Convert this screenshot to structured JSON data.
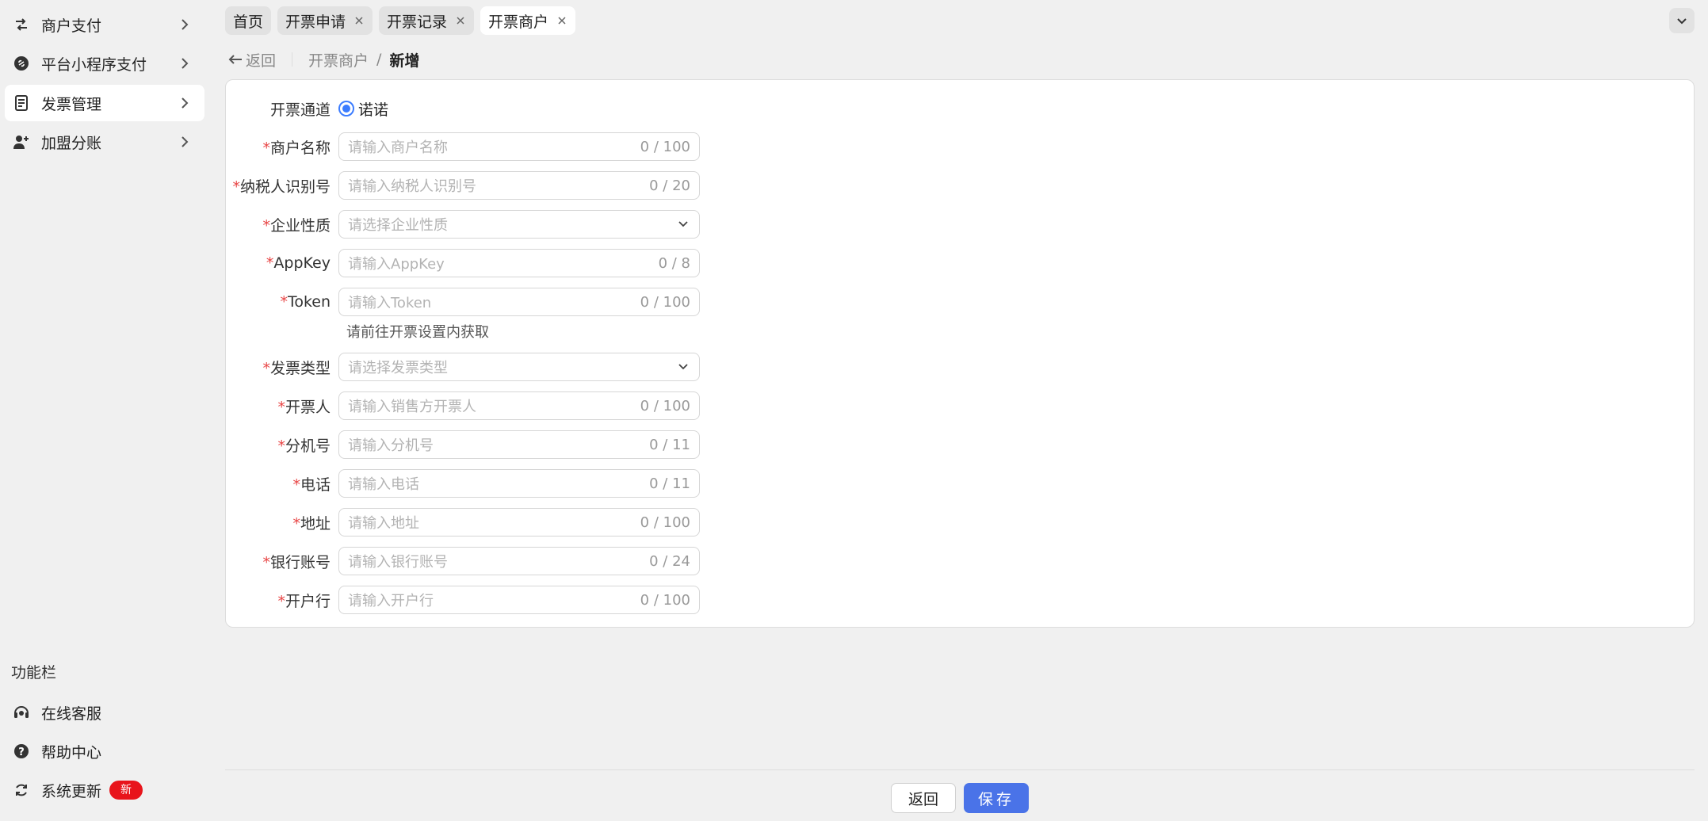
{
  "sidebar": {
    "items": [
      {
        "label": "商户支付",
        "icon": "transfer-icon"
      },
      {
        "label": "平台小程序支付",
        "icon": "link-icon"
      },
      {
        "label": "发票管理",
        "icon": "receipt-icon"
      },
      {
        "label": "加盟分账",
        "icon": "user-add-icon"
      }
    ],
    "func_title": "功能栏",
    "func_items": [
      {
        "label": "在线客服",
        "icon": "headset-icon"
      },
      {
        "label": "帮助中心",
        "icon": "help-icon"
      },
      {
        "label": "系统更新",
        "icon": "refresh-icon",
        "badge": "新"
      }
    ]
  },
  "tabs": [
    {
      "label": "首页",
      "closable": false
    },
    {
      "label": "开票申请",
      "closable": true
    },
    {
      "label": "开票记录",
      "closable": true
    },
    {
      "label": "开票商户",
      "closable": true,
      "active": true
    }
  ],
  "breadcrumb": {
    "back": "返回",
    "parent": "开票商户",
    "separator": "/",
    "current": "新增"
  },
  "form": {
    "channel": {
      "label": "开票通道",
      "option": "诺诺"
    },
    "merchant_name": {
      "label": "商户名称",
      "placeholder": "请输入商户名称",
      "count": "0 / 100"
    },
    "tax_id": {
      "label": "纳税人识别号",
      "placeholder": "请输入纳税人识别号",
      "count": "0 / 20"
    },
    "enterprise_type": {
      "label": "企业性质",
      "placeholder": "请选择企业性质"
    },
    "app_key": {
      "label": "AppKey",
      "placeholder": "请输入AppKey",
      "count": "0 / 8"
    },
    "token": {
      "label": "Token",
      "placeholder": "请输入Token",
      "count": "0 / 100",
      "hint": "请前往开票设置内获取"
    },
    "invoice_type": {
      "label": "发票类型",
      "placeholder": "请选择发票类型"
    },
    "issuer": {
      "label": "开票人",
      "placeholder": "请输入销售方开票人",
      "count": "0 / 100"
    },
    "extension": {
      "label": "分机号",
      "placeholder": "请输入分机号",
      "count": "0 / 11"
    },
    "phone": {
      "label": "电话",
      "placeholder": "请输入电话",
      "count": "0 / 11"
    },
    "address": {
      "label": "地址",
      "placeholder": "请输入地址",
      "count": "0 / 100"
    },
    "bank_account": {
      "label": "银行账号",
      "placeholder": "请输入银行账号",
      "count": "0 / 24"
    },
    "bank_name": {
      "label": "开户行",
      "placeholder": "请输入开户行",
      "count": "0 / 100"
    }
  },
  "footer": {
    "back_label": "返回",
    "save_label": "保存"
  },
  "colors": {
    "primary": "#4a73e8",
    "required": "#e84545",
    "badge": "#e8141b"
  }
}
